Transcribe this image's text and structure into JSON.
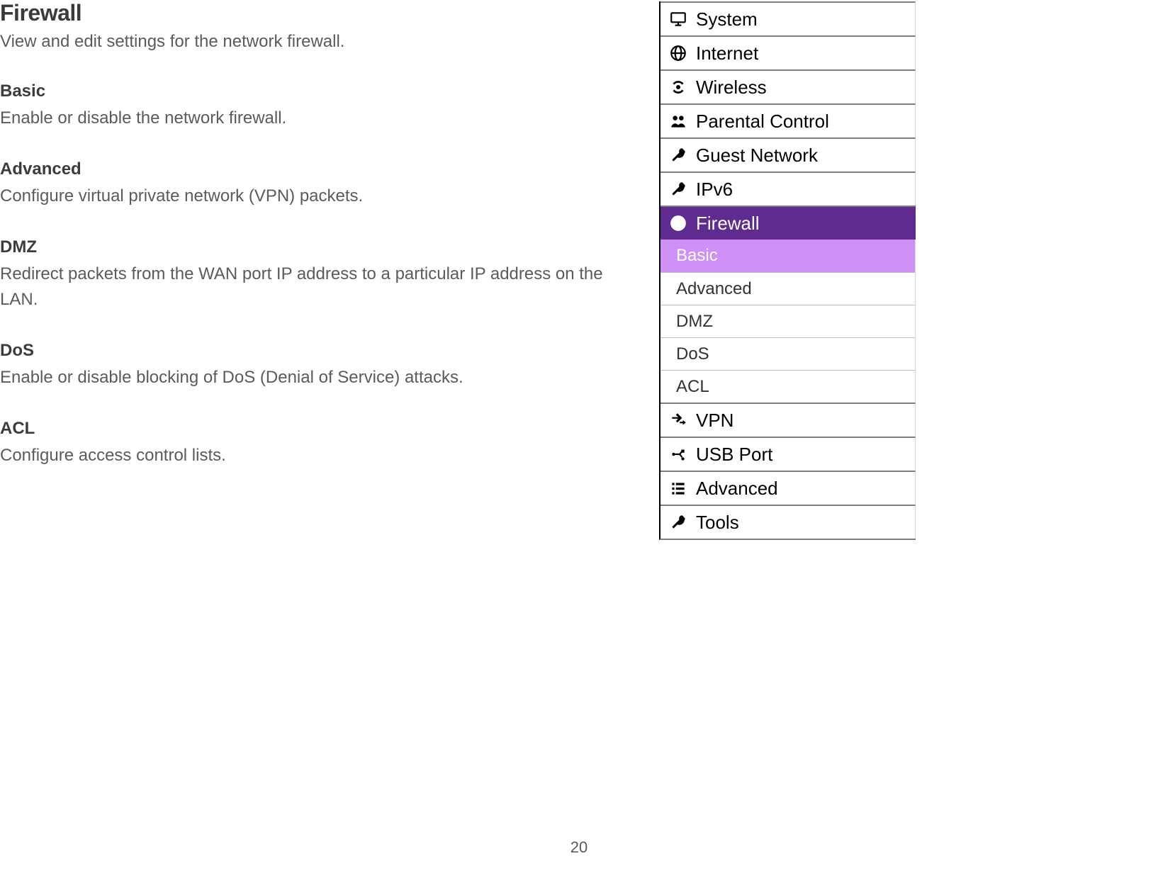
{
  "content": {
    "title": "Firewall",
    "intro": "View and edit settings for the network firewall.",
    "sections": [
      {
        "title": "Basic",
        "desc": "Enable or disable the network firewall."
      },
      {
        "title": "Advanced",
        "desc": "Configure virtual private network (VPN) packets."
      },
      {
        "title": "DMZ",
        "desc": "Redirect packets from the WAN port IP address to a particular IP address on the LAN."
      },
      {
        "title": "DoS",
        "desc": "Enable or disable blocking of DoS (Denial of Service) attacks."
      },
      {
        "title": "ACL",
        "desc": "Configure access control lists."
      }
    ]
  },
  "sidebar": {
    "items": [
      {
        "label": "System",
        "icon": "monitor-icon",
        "active": false
      },
      {
        "label": "Internet",
        "icon": "globe-icon",
        "active": false
      },
      {
        "label": "Wireless",
        "icon": "wifi-icon",
        "active": false
      },
      {
        "label": "Parental Control",
        "icon": "users-icon",
        "active": false
      },
      {
        "label": "Guest Network",
        "icon": "wrench-icon",
        "active": false
      },
      {
        "label": "IPv6",
        "icon": "wrench-icon",
        "active": false
      },
      {
        "label": "Firewall",
        "icon": "firewall-icon",
        "active": true,
        "subitems": [
          {
            "label": "Basic",
            "selected": true
          },
          {
            "label": "Advanced",
            "selected": false
          },
          {
            "label": "DMZ",
            "selected": false
          },
          {
            "label": "DoS",
            "selected": false
          },
          {
            "label": "ACL",
            "selected": false
          }
        ]
      },
      {
        "label": "VPN",
        "icon": "vpn-icon",
        "active": false
      },
      {
        "label": "USB Port",
        "icon": "usb-icon",
        "active": false
      },
      {
        "label": "Advanced",
        "icon": "list-icon",
        "active": false
      },
      {
        "label": "Tools",
        "icon": "wrench-icon",
        "active": false
      }
    ]
  },
  "page_number": "20"
}
